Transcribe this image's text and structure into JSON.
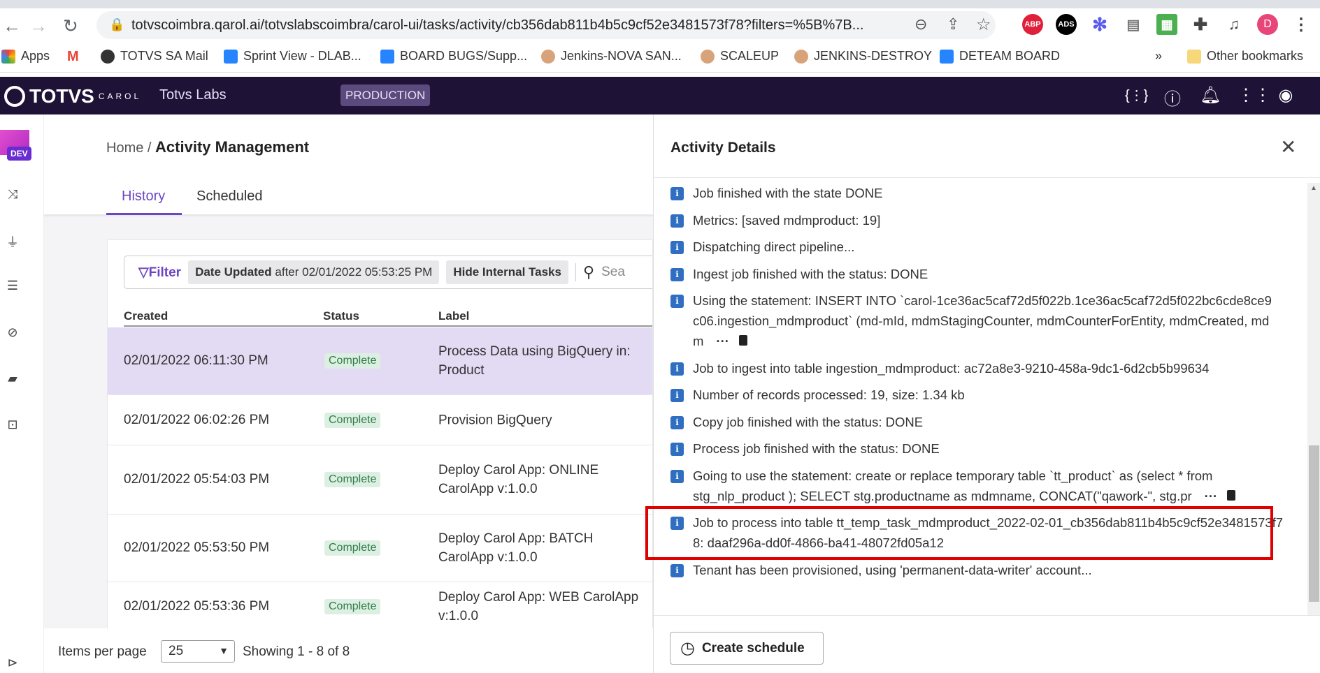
{
  "browser": {
    "url": "totvscoimbra.qarol.ai/totvslabscoimbra/carol-ui/tasks/activity/cb356dab811b4b5c9cf52e3481573f78?filters=%5B%7B...",
    "extensions": [
      "ABP",
      "ADS"
    ],
    "profile_initial": "D",
    "bookmarks": [
      "Apps",
      "TOTVS SA Mail",
      "Sprint View - DLAB...",
      "BOARD BUGS/Supp...",
      "Jenkins-NOVA SAN...",
      "SCALEUP",
      "JENKINS-DESTROY",
      "DETEAM BOARD"
    ],
    "overflow": "»",
    "other_bookmarks": "Other bookmarks"
  },
  "app": {
    "logo": "TOTVS",
    "logo_sub": "CAROL",
    "org": "Totvs Labs",
    "env": "PRODUCTION",
    "dev_badge": "DEV"
  },
  "main": {
    "breadcrumb_home": "Home /",
    "title": "Activity Management",
    "tabs": [
      "History",
      "Scheduled"
    ],
    "filter": {
      "label": "Filter",
      "chip1_key": "Date Updated",
      "chip1_val": "after 02/01/2022 05:53:25 PM",
      "chip2": "Hide Internal Tasks",
      "search_placeholder": "Sea"
    },
    "columns": [
      "Created",
      "Status",
      "Label"
    ],
    "rows": [
      {
        "created": "02/01/2022 06:11:30 PM",
        "status": "Complete",
        "label": "Process Data using BigQuery in: Product"
      },
      {
        "created": "02/01/2022 06:02:26 PM",
        "status": "Complete",
        "label": "Provision BigQuery"
      },
      {
        "created": "02/01/2022 05:54:03 PM",
        "status": "Complete",
        "label": "Deploy Carol App: ONLINE CarolApp v:1.0.0"
      },
      {
        "created": "02/01/2022 05:53:50 PM",
        "status": "Complete",
        "label": "Deploy Carol App: BATCH CarolApp v:1.0.0"
      },
      {
        "created": "02/01/2022 05:53:36 PM",
        "status": "Complete",
        "label": "Deploy Carol App: WEB CarolApp v:1.0.0"
      }
    ],
    "items_per_page_label": "Items per page",
    "items_per_page": "25",
    "showing": "Showing 1 - 8 of 8"
  },
  "panel": {
    "title": "Activity Details",
    "logs": [
      "Job finished with the state DONE",
      "Metrics: [saved mdmproduct: 19]",
      "Dispatching direct pipeline...",
      "Ingest job finished with the status: DONE",
      "Using the statement: INSERT INTO `carol-1ce36ac5caf72d5f022b.1ce36ac5caf72d5f022bc6cde8ce9c06.ingestion_mdmproduct` (md-mId, mdmStagingCounter, mdmCounterForEntity, mdmCreated, mdm",
      "Job to ingest into table ingestion_mdmproduct: ac72a8e3-9210-458a-9dc1-6d2cb5b99634",
      "Number of records processed: 19, size: 1.34 kb",
      "Copy job finished with the status: DONE",
      "Process job finished with the status: DONE",
      "Going to use the statement: create or replace temporary table `tt_product` as (select * from stg_nlp_product ); SELECT stg.productname as mdmname, CONCAT(\"qawork-\", stg.pr",
      "Job to process into table tt_temp_task_mdmproduct_2022-02-01_cb356dab811b4b5c9cf52e3481573f78: daaf296a-dd0f-4866-ba41-48072fd05a12",
      "Tenant has been provisioned, using 'permanent-data-writer' account..."
    ],
    "more": "···",
    "create_schedule": "Create schedule",
    "highlight_color": "#e00000"
  }
}
